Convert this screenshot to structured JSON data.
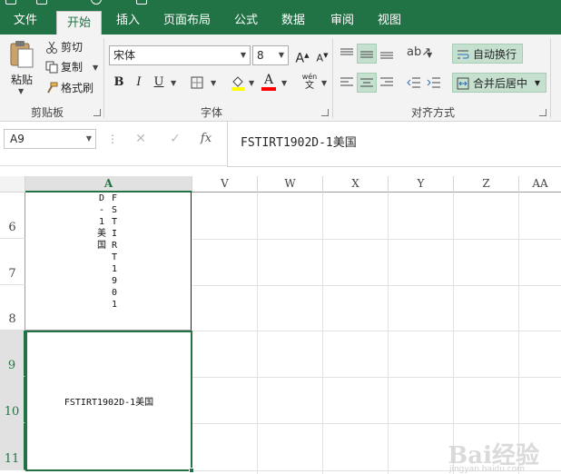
{
  "ribbon_tabs": [
    "文件",
    "开始",
    "插入",
    "页面布局",
    "公式",
    "数据",
    "审阅",
    "视图"
  ],
  "clipboard": {
    "paste_label": "粘贴",
    "cut_label": "剪切",
    "copy_label": "复制",
    "format_painter_label": "格式刷",
    "group_label": "剪贴板"
  },
  "font": {
    "name": "宋体",
    "size": "8",
    "bold": "B",
    "italic": "I",
    "underline": "U",
    "phonetic": "wén",
    "phonetic_sub": "文",
    "group_label": "字体",
    "fill_color": "#ffff00",
    "font_color": "#ff0000"
  },
  "alignment": {
    "wrap_text_label": "自动换行",
    "merge_center_label": "合并后居中",
    "group_label": "对齐方式"
  },
  "formula_bar": {
    "name_box": "A9",
    "content": "FSTIRT1902D-1美国",
    "fx": "fx"
  },
  "columns": [
    "A",
    "V",
    "W",
    "X",
    "Y",
    "Z",
    "AA"
  ],
  "rows": [
    "6",
    "7",
    "8",
    "9",
    "10",
    "11"
  ],
  "cells": {
    "merged_vertical_col1": [
      "D",
      "-",
      "1",
      "",
      "美",
      "国"
    ],
    "merged_vertical_col2": [
      "F",
      "S",
      "T",
      "I",
      "R",
      "T",
      "1",
      "9",
      "0",
      "1"
    ],
    "a9": "FSTIRT1902D-1美国"
  },
  "colors": {
    "accent": "#217346",
    "selected_fill": "#c5e0cf"
  },
  "watermark": {
    "text": "Bai经验",
    "sub": "jingyan.baidu.com"
  }
}
